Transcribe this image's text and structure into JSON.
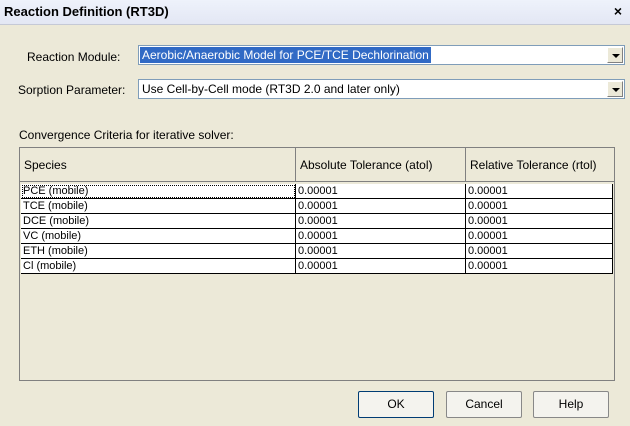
{
  "window": {
    "title": "Reaction Definition (RT3D)",
    "close_glyph": "×"
  },
  "form": {
    "reaction_module_label": "Reaction Module:",
    "reaction_module_value": "Aerobic/Anaerobic Model for PCE/TCE Dechlorination",
    "sorption_label": "Sorption Parameter:",
    "sorption_value": "Use Cell-by-Cell mode (RT3D 2.0 and later only)",
    "convergence_label": "Convergence Criteria for iterative solver:"
  },
  "table": {
    "columns": [
      "Species",
      "Absolute Tolerance (atol)",
      "Relative Tolerance (rtol)"
    ],
    "rows": [
      [
        "PCE (mobile)",
        "0.00001",
        "0.00001"
      ],
      [
        "TCE (mobile)",
        "0.00001",
        "0.00001"
      ],
      [
        "DCE (mobile)",
        "0.00001",
        "0.00001"
      ],
      [
        "VC (mobile)",
        "0.00001",
        "0.00001"
      ],
      [
        "ETH (mobile)",
        "0.00001",
        "0.00001"
      ],
      [
        "Cl (mobile)",
        "0.00001",
        "0.00001"
      ]
    ]
  },
  "buttons": {
    "ok": "OK",
    "cancel": "Cancel",
    "help": "Help"
  },
  "colors": {
    "dialog_bg": "#ECE9D8",
    "selection": "#316AC5"
  }
}
